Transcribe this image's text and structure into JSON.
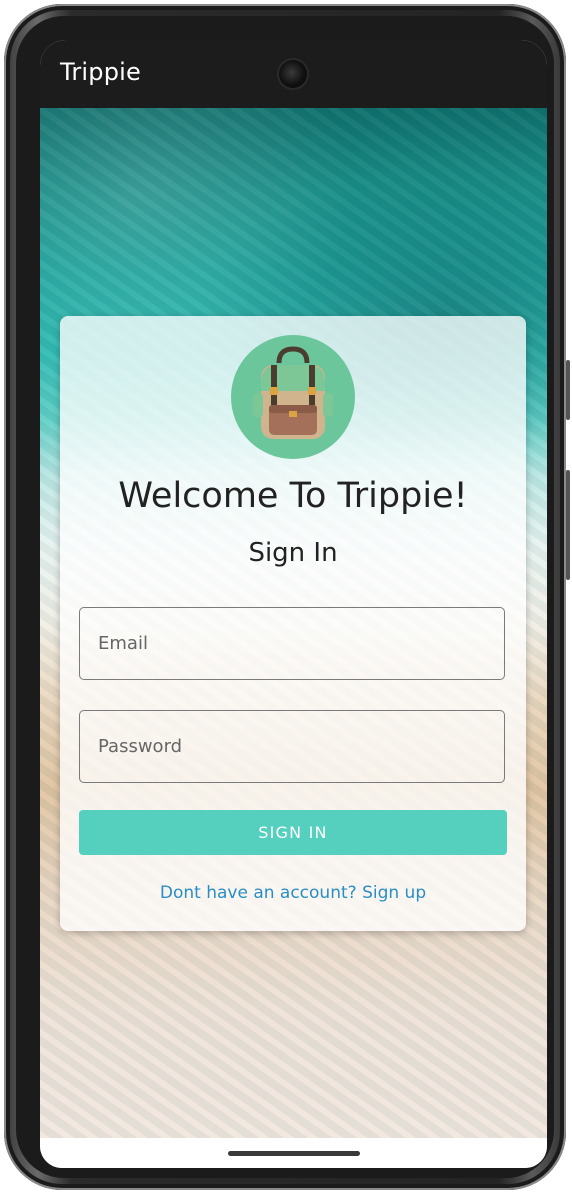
{
  "app": {
    "title": "Trippie"
  },
  "card": {
    "logo_icon": "backpack-icon",
    "welcome_text": "Welcome To Trippie!",
    "heading": "Sign In",
    "email_placeholder": "Email",
    "password_placeholder": "Password",
    "signin_button": "SIGN IN",
    "signup_link": "Dont have an account? Sign up"
  },
  "colors": {
    "accent": "#56d0be",
    "link": "#2a8ec2",
    "appbar": "#1c1c1c",
    "logo_bg": "#6cc69c"
  }
}
